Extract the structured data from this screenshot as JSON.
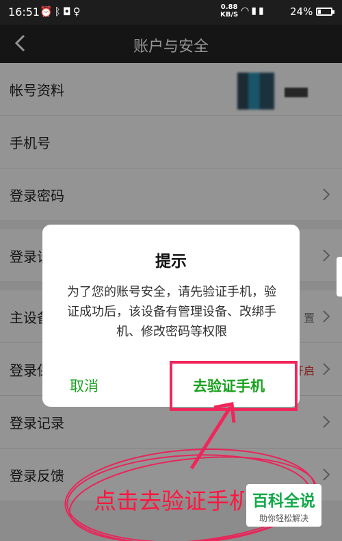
{
  "status_bar": {
    "time": "16:51",
    "left_icons": [
      "alarm-icon",
      "bluetooth-icon",
      "shield-icon",
      "qq-icon"
    ],
    "network_speed_value": "0.88",
    "network_speed_unit": "KB/S",
    "right_icons": [
      "wifi-icon",
      "signal-icon",
      "4g-signal-icon"
    ],
    "battery": "24%",
    "battery_level": 0.24
  },
  "header": {
    "title": "账户与安全",
    "back_icon": "back-chevron-icon"
  },
  "settings_list": {
    "items": [
      {
        "label": "帐号资料",
        "value": "",
        "has_avatar": true
      },
      {
        "label": "手机号",
        "value": ""
      },
      {
        "label": "登录密码",
        "value": ""
      },
      {
        "label": "登录设",
        "value": ""
      },
      {
        "label": "主设备",
        "value": "置"
      },
      {
        "label": "登录保",
        "value": "开启"
      },
      {
        "label": "登录记录",
        "value": ""
      },
      {
        "label": "登录反馈",
        "value": ""
      }
    ]
  },
  "dialog": {
    "title": "提示",
    "message": "为了您的账号安全，请先验证手机，验证成功后，该设备有管理设备、改绑手机、修改密码等权限",
    "cancel_label": "取消",
    "confirm_label": "去验证手机"
  },
  "annotation": {
    "text": "点击去验证手机",
    "color": "#ff1740"
  },
  "watermark": {
    "title": "百科全说",
    "subtitle": "助你轻松解决"
  },
  "colors": {
    "accent_green": "#19a11e",
    "header_bg": "#252525",
    "status_bg": "#1d1d1d"
  }
}
